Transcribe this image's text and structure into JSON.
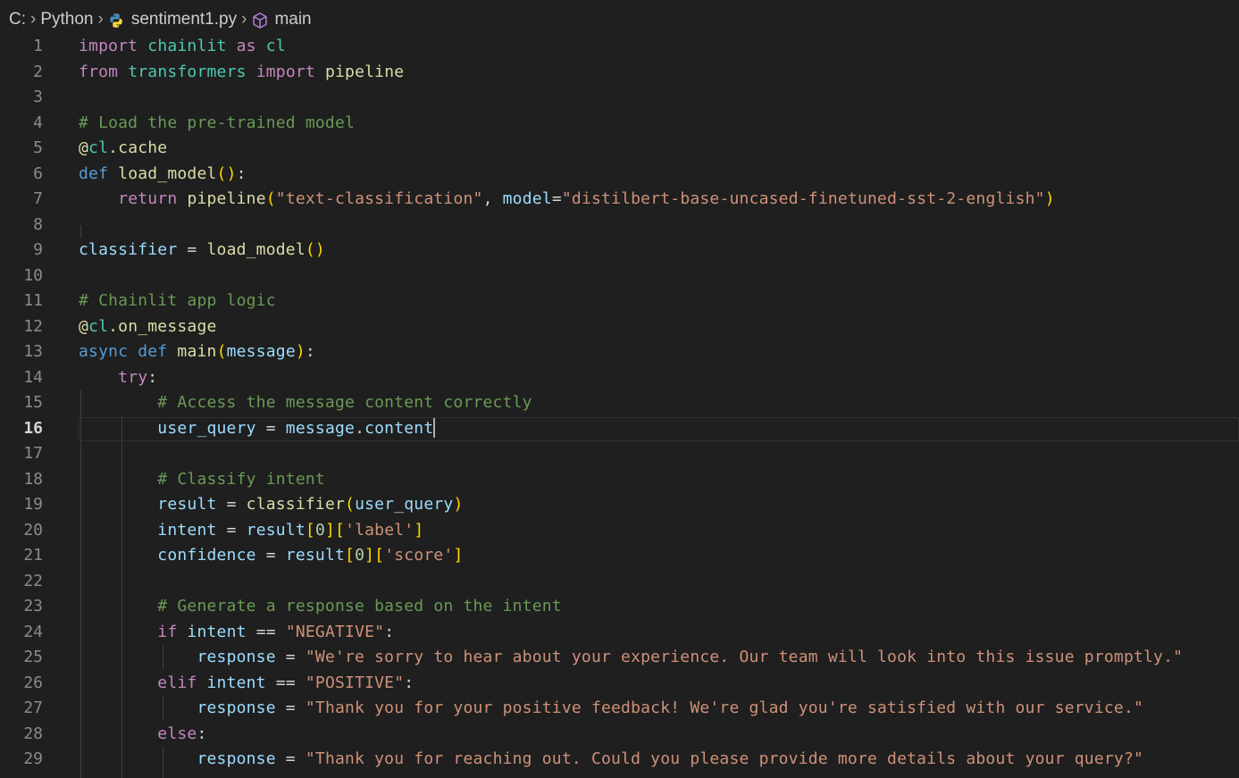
{
  "breadcrumb": {
    "drive": "C:",
    "folder": "Python",
    "file": "sentiment1.py",
    "symbol": "main"
  },
  "editor": {
    "active_line": 16,
    "lines": [
      {
        "n": "1",
        "t": [
          [
            "k",
            "import"
          ],
          [
            "w",
            " "
          ],
          [
            "m",
            "chainlit"
          ],
          [
            "w",
            " "
          ],
          [
            "k",
            "as"
          ],
          [
            "w",
            " "
          ],
          [
            "m",
            "cl"
          ]
        ]
      },
      {
        "n": "2",
        "t": [
          [
            "k",
            "from"
          ],
          [
            "w",
            " "
          ],
          [
            "m",
            "transformers"
          ],
          [
            "w",
            " "
          ],
          [
            "k",
            "import"
          ],
          [
            "w",
            " "
          ],
          [
            "f",
            "pipeline"
          ]
        ]
      },
      {
        "n": "3",
        "t": []
      },
      {
        "n": "4",
        "t": [
          [
            "c",
            "# Load the pre-trained model"
          ]
        ]
      },
      {
        "n": "5",
        "t": [
          [
            "f",
            "@"
          ],
          [
            "m",
            "cl"
          ],
          [
            "f",
            ".cache"
          ]
        ]
      },
      {
        "n": "6",
        "t": [
          [
            "b",
            "def"
          ],
          [
            "w",
            " "
          ],
          [
            "f",
            "load_model"
          ],
          [
            "p1",
            "()"
          ],
          [
            "w",
            ":"
          ]
        ]
      },
      {
        "n": "7",
        "t": [
          [
            "w",
            "    "
          ],
          [
            "k",
            "return"
          ],
          [
            "w",
            " "
          ],
          [
            "f",
            "pipeline"
          ],
          [
            "p1",
            "("
          ],
          [
            "s",
            "\"text-classification\""
          ],
          [
            "w",
            ", "
          ],
          [
            "v",
            "model"
          ],
          [
            "w",
            "="
          ],
          [
            "s",
            "\"distilbert-base-uncased-finetuned-sst-2-english\""
          ],
          [
            "p1",
            ")"
          ]
        ]
      },
      {
        "n": "8",
        "t": []
      },
      {
        "n": "9",
        "t": [
          [
            "v",
            "classifier"
          ],
          [
            "w",
            " = "
          ],
          [
            "f",
            "load_model"
          ],
          [
            "p1",
            "()"
          ]
        ]
      },
      {
        "n": "10",
        "t": []
      },
      {
        "n": "11",
        "t": [
          [
            "c",
            "# Chainlit app logic"
          ]
        ]
      },
      {
        "n": "12",
        "t": [
          [
            "f",
            "@"
          ],
          [
            "m",
            "cl"
          ],
          [
            "f",
            ".on_message"
          ]
        ]
      },
      {
        "n": "13",
        "t": [
          [
            "b",
            "async"
          ],
          [
            "w",
            " "
          ],
          [
            "b",
            "def"
          ],
          [
            "w",
            " "
          ],
          [
            "f",
            "main"
          ],
          [
            "p1",
            "("
          ],
          [
            "v",
            "message"
          ],
          [
            "p1",
            ")"
          ],
          [
            "w",
            ":"
          ]
        ]
      },
      {
        "n": "14",
        "t": [
          [
            "w",
            "    "
          ],
          [
            "k",
            "try"
          ],
          [
            "w",
            ":"
          ]
        ]
      },
      {
        "n": "15",
        "t": [
          [
            "w",
            "        "
          ],
          [
            "c",
            "# Access the message content correctly"
          ]
        ]
      },
      {
        "n": "16",
        "t": [
          [
            "w",
            "        "
          ],
          [
            "v",
            "user_query"
          ],
          [
            "w",
            " = "
          ],
          [
            "v",
            "message"
          ],
          [
            "w",
            "."
          ],
          [
            "v",
            "content"
          ]
        ]
      },
      {
        "n": "17",
        "t": []
      },
      {
        "n": "18",
        "t": [
          [
            "w",
            "        "
          ],
          [
            "c",
            "# Classify intent"
          ]
        ]
      },
      {
        "n": "19",
        "t": [
          [
            "w",
            "        "
          ],
          [
            "v",
            "result"
          ],
          [
            "w",
            " = "
          ],
          [
            "f",
            "classifier"
          ],
          [
            "p1",
            "("
          ],
          [
            "v",
            "user_query"
          ],
          [
            "p1",
            ")"
          ]
        ]
      },
      {
        "n": "20",
        "t": [
          [
            "w",
            "        "
          ],
          [
            "v",
            "intent"
          ],
          [
            "w",
            " = "
          ],
          [
            "v",
            "result"
          ],
          [
            "p1",
            "["
          ],
          [
            "n",
            "0"
          ],
          [
            "p1",
            "]["
          ],
          [
            "s",
            "'label'"
          ],
          [
            "p1",
            "]"
          ]
        ]
      },
      {
        "n": "21",
        "t": [
          [
            "w",
            "        "
          ],
          [
            "v",
            "confidence"
          ],
          [
            "w",
            " = "
          ],
          [
            "v",
            "result"
          ],
          [
            "p1",
            "["
          ],
          [
            "n",
            "0"
          ],
          [
            "p1",
            "]["
          ],
          [
            "s",
            "'score'"
          ],
          [
            "p1",
            "]"
          ]
        ]
      },
      {
        "n": "22",
        "t": []
      },
      {
        "n": "23",
        "t": [
          [
            "w",
            "        "
          ],
          [
            "c",
            "# Generate a response based on the intent"
          ]
        ]
      },
      {
        "n": "24",
        "t": [
          [
            "w",
            "        "
          ],
          [
            "k",
            "if"
          ],
          [
            "w",
            " "
          ],
          [
            "v",
            "intent"
          ],
          [
            "w",
            " == "
          ],
          [
            "s",
            "\"NEGATIVE\""
          ],
          [
            "w",
            ":"
          ]
        ]
      },
      {
        "n": "25",
        "t": [
          [
            "w",
            "            "
          ],
          [
            "v",
            "response"
          ],
          [
            "w",
            " = "
          ],
          [
            "s",
            "\"We're sorry to hear about your experience. Our team will look into this issue promptly.\""
          ]
        ]
      },
      {
        "n": "26",
        "t": [
          [
            "w",
            "        "
          ],
          [
            "k",
            "elif"
          ],
          [
            "w",
            " "
          ],
          [
            "v",
            "intent"
          ],
          [
            "w",
            " == "
          ],
          [
            "s",
            "\"POSITIVE\""
          ],
          [
            "w",
            ":"
          ]
        ]
      },
      {
        "n": "27",
        "t": [
          [
            "w",
            "            "
          ],
          [
            "v",
            "response"
          ],
          [
            "w",
            " = "
          ],
          [
            "s",
            "\"Thank you for your positive feedback! We're glad you're satisfied with our service.\""
          ]
        ]
      },
      {
        "n": "28",
        "t": [
          [
            "w",
            "        "
          ],
          [
            "k",
            "else"
          ],
          [
            "w",
            ":"
          ]
        ]
      },
      {
        "n": "29",
        "t": [
          [
            "w",
            "            "
          ],
          [
            "v",
            "response"
          ],
          [
            "w",
            " = "
          ],
          [
            "s",
            "\"Thank you for reaching out. Could you please provide more details about your query?\""
          ]
        ]
      }
    ]
  }
}
